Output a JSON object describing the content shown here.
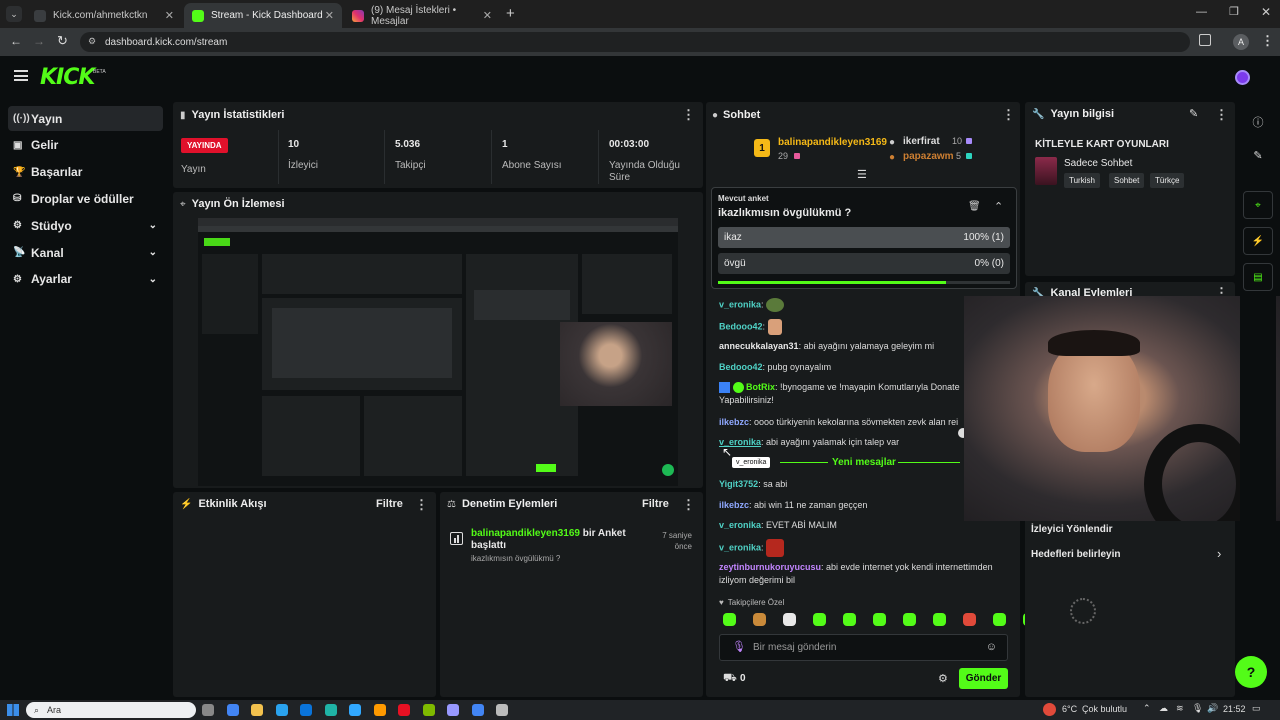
{
  "browser": {
    "tabs": [
      {
        "label": "Kick.com/ahmetkctkn",
        "active": false
      },
      {
        "label": "Stream - Kick Dashboard",
        "active": true
      },
      {
        "label": "(9) Mesaj İstekleri • Mesajlar",
        "active": false
      }
    ],
    "url": "dashboard.kick.com/stream",
    "profile": "A"
  },
  "header": {
    "logo": "KICK",
    "beta": "BETA"
  },
  "sidebar": {
    "items": [
      {
        "label": "Yayın",
        "icon": "broadcast-icon",
        "selected": true,
        "chevron": false
      },
      {
        "label": "Gelir",
        "icon": "revenue-icon",
        "selected": false,
        "chevron": false
      },
      {
        "label": "Başarılar",
        "icon": "trophy-icon",
        "selected": false,
        "chevron": false
      },
      {
        "label": "Droplar ve ödüller",
        "icon": "gift-icon",
        "selected": false,
        "chevron": false
      },
      {
        "label": "Stüdyo",
        "icon": "studio-icon",
        "selected": false,
        "chevron": true
      },
      {
        "label": "Kanal",
        "icon": "channel-icon",
        "selected": false,
        "chevron": true
      },
      {
        "label": "Ayarlar",
        "icon": "settings-icon",
        "selected": false,
        "chevron": true
      }
    ]
  },
  "stats": {
    "title": "Yayın İstatistikleri",
    "live_badge": "YAYINDA",
    "live_label": "Yayın",
    "items": [
      {
        "value": "10",
        "label": "İzleyici"
      },
      {
        "value": "5.036",
        "label": "Takipçi"
      },
      {
        "value": "1",
        "label": "Abone Sayısı"
      },
      {
        "value": "00:03:00",
        "label": "Yayında Olduğu Süre"
      }
    ]
  },
  "preview": {
    "title": "Yayın Ön İzlemesi"
  },
  "activity": {
    "title": "Etkinlik Akışı",
    "filter": "Filtre"
  },
  "moderation": {
    "title": "Denetim Eylemleri",
    "filter": "Filtre",
    "entry": {
      "user": "balinapandikleyen3169",
      "action": "bir Anket başlattı",
      "detail": "ikazlıkmısın övgülükmü ?",
      "time": "7 saniye önce"
    }
  },
  "chat": {
    "title": "Sohbet",
    "top": {
      "rank1": {
        "user": "balinapandikleyen3169",
        "count": "29"
      },
      "rank2": {
        "user": "ikerfirat",
        "count": "10"
      },
      "rank3": {
        "user": "papazawm",
        "count": "5"
      }
    },
    "poll": {
      "label": "Mevcut anket",
      "question": "ikazlıkmısın övgülükmü ?",
      "options": [
        {
          "text": "ikaz",
          "result": "100% (1)",
          "percent": 100
        },
        {
          "text": "övgü",
          "result": "0% (0)",
          "percent": 0
        }
      ],
      "progress": 0.78
    },
    "messages": [
      {
        "user": "v_eronika",
        "color": "#4fd1c5",
        "text": ""
      },
      {
        "user": "Bedooo42",
        "color": "#4fd1c5",
        "text": ""
      },
      {
        "user": "annecukkalayan31",
        "color": "#e8e8e8",
        "text": "abi ayağını yalamaya geleyim mi"
      },
      {
        "user": "Bedooo42",
        "color": "#4fd1c5",
        "text": "pubg oynayalım"
      },
      {
        "user": "BotRix",
        "color": "#53fc18",
        "text": "!bynogame ve !mayapin Komutlarıyla Donate Yapabilirsiniz!"
      },
      {
        "user": "ilkebzc",
        "color": "#8fa8ff",
        "text": "oooo türkiyenin kekolarına sövmekten zevk alan rei"
      },
      {
        "user": "v_eronika",
        "color": "#4fd1c5",
        "text": "abi ayağını yalamak için talep var"
      },
      {
        "user": "Yigit3752",
        "color": "#4fd1c5",
        "text": "sa abi"
      },
      {
        "user": "ilkebzc",
        "color": "#8fa8ff",
        "text": "abi win 11 ne zaman geççen"
      },
      {
        "user": "v_eronika",
        "color": "#4fd1c5",
        "text": "EVET ABİ MALIM"
      },
      {
        "user": "v_eronika",
        "color": "#4fd1c5",
        "text": ""
      },
      {
        "user": "zeytinburnukoruyucusu",
        "color": "#c084fc",
        "text": "abi evde internet yok kendi internettimden izliyom değerimi bil"
      }
    ],
    "tooltip": "v_eronika",
    "new_messages": "Yeni mesajlar",
    "followers_only": "Takipçilere Özel",
    "input_placeholder": "Bir mesaj gönderin",
    "count": "0",
    "send": "Gönder"
  },
  "stream_info": {
    "title": "Yayın bilgisi",
    "stream_title": "KİTLEYLE KART OYUNLARI",
    "category": "Sadece Sohbet",
    "tags": [
      "Turkish",
      "Sohbet",
      "Türkçe"
    ]
  },
  "channel_actions": {
    "title": "Kanal Eylemleri",
    "redirect": "İzleyici Yönlendir",
    "goals": "Hedefleri belirleyin"
  },
  "taskbar": {
    "search": "Ara",
    "weather_temp": "6°C",
    "weather_text": "Çok bulutlu",
    "time": "21:52"
  }
}
